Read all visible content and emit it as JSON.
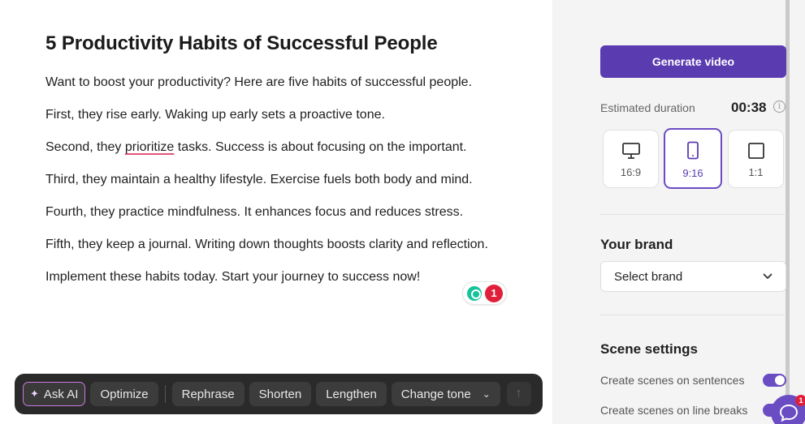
{
  "editor": {
    "title": "5 Productivity Habits of Successful People",
    "paragraphs": [
      "Want to boost your productivity? Here are five habits of successful people.",
      "First, they rise early. Waking up early sets a proactive tone.",
      "Third, they maintain a healthy lifestyle. Exercise fuels both body and mind.",
      "Fourth, they practice mindfulness. It enhances focus and reduces stress.",
      "Fifth, they keep a journal. Writing down thoughts boosts clarity and reflection.",
      "Implement these habits today. Start your journey to success now!"
    ],
    "para3": {
      "before": "Second, they ",
      "flagged": "prioritize",
      "after": " tasks. Success is about focusing on the important."
    },
    "grammarly_count": "1"
  },
  "toolbar": {
    "ask_ai": "Ask AI",
    "optimize": "Optimize",
    "rephrase": "Rephrase",
    "shorten": "Shorten",
    "lengthen": "Lengthen",
    "change_tone": "Change tone"
  },
  "panel": {
    "generate_label": "Generate video",
    "duration_label": "Estimated duration",
    "duration_value": "00:38",
    "ratios": [
      "16:9",
      "9:16",
      "1:1"
    ],
    "selected_ratio": "9:16",
    "brand_title": "Your brand",
    "brand_placeholder": "Select brand",
    "scene_title": "Scene settings",
    "settings": [
      {
        "label": "Create scenes on sentences",
        "on": true
      },
      {
        "label": "Create scenes on line breaks",
        "on": true
      }
    ],
    "chat_badge": "1"
  },
  "colors": {
    "accent": "#5b3bb0",
    "toolbar_bg": "#2a2a2a",
    "panel_bg": "#f4f4f4"
  }
}
